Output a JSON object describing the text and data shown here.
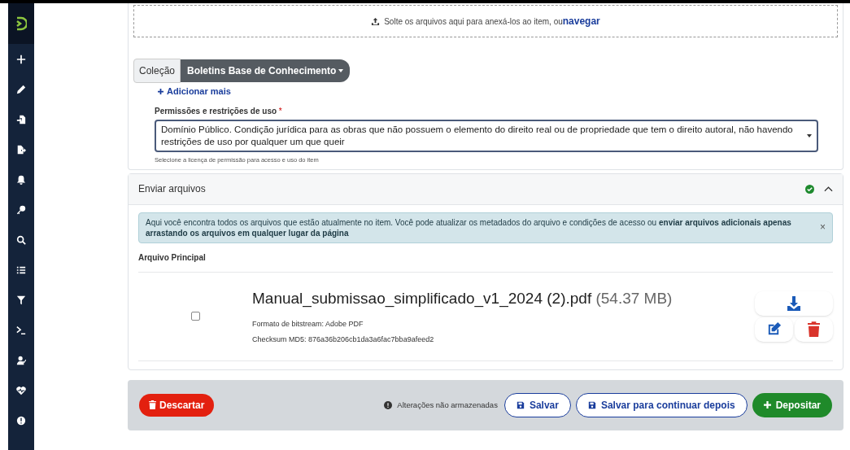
{
  "upload_zone": {
    "text": "Solte os arquivos aqui para anexá-los ao item, ou",
    "link": "navegar"
  },
  "collection": {
    "label": "Coleção",
    "value": "Boletins Base de Conhecimento"
  },
  "add_more": "Adicionar mais",
  "license": {
    "label": "Permissões e restrições de uso",
    "required_mark": "*",
    "value": "Domínio Público. Condição jurídica para as obras que não possuem o elemento do direito real ou de propriedade que tem o direito autoral, não havendo restrições de uso por qualquer um que queir",
    "hint": "Selecione a licença de permissão para acesso e uso do item"
  },
  "files_section": {
    "title": "Enviar arquivos",
    "complete": true,
    "expanded": true,
    "alert": {
      "text": "Aqui você encontra todos os arquivos que estão atualmente no item. Você pode atualizar os metadados do arquivo e condições de acesso ou **enviar arquivos adicionais apenas arrastando os arquivos em qualquer lugar da página**",
      "close": "×"
    },
    "primary_label": "Arquivo Principal",
    "files": [
      {
        "name": "Manual_submissao_simplificado_v1_2024 (2).pdf",
        "size": "(54.37 MB)",
        "format": "Formato de bitstream: Adobe PDF",
        "checksum": "Checksum MD5: 876a36b206cb1da3a6fac7bba9afeed2",
        "checked": false
      }
    ]
  },
  "footer": {
    "discard": "Descartar",
    "unsaved": "Alterações não armazenadas",
    "save": "Salvar",
    "save_later": "Salvar para continuar depois",
    "deposit": "Depositar"
  }
}
